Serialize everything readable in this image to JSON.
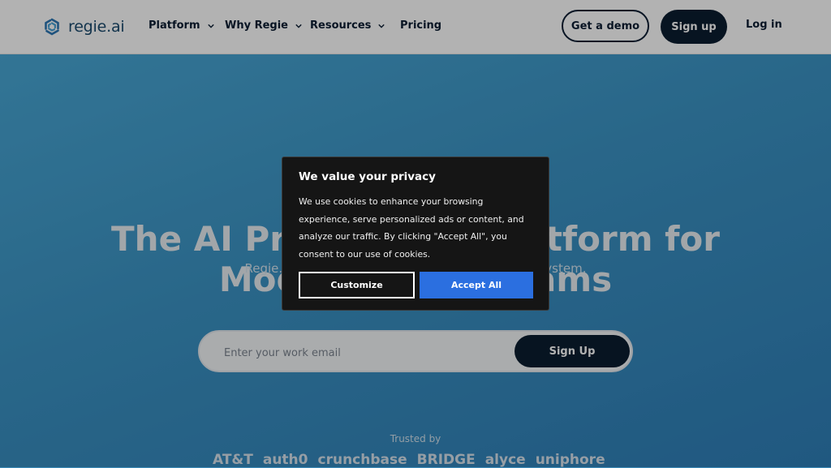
{
  "brand": {
    "name": "regie.ai",
    "color": "#1a4a6e"
  },
  "nav": {
    "items": [
      {
        "label": "Platform"
      },
      {
        "label": "Why Regie"
      },
      {
        "label": "Resources"
      },
      {
        "label": "Pricing"
      }
    ],
    "demo_label": "Get a demo",
    "signup_label": "Sign up",
    "login_label": "Log in"
  },
  "hero": {
    "title_line1": "The AI Prospecting Platform for",
    "title_line2": "Modern Sales Teams",
    "subtitle": "Regie.ai is your AI-native prospect engagement system.",
    "email_placeholder": "Enter your work email",
    "signup_label": "Sign Up",
    "trusted_label": "Trusted by",
    "logos": [
      "AT&T",
      "auth0",
      "crunchbase",
      "BRIDGE",
      "alyce",
      "uniphore"
    ]
  },
  "cookie": {
    "title": "We value your privacy",
    "body": "We use cookies to enhance your browsing experience, serve personalized ads or content, and analyze our traffic. By clicking \"Accept All\", you consent to our use of cookies.",
    "customize_label": "Customize",
    "accept_label": "Accept All"
  },
  "colors": {
    "hero_bg": "#3b93c4",
    "dark_button": "#0b1d30",
    "accept_button": "#2b6fe0",
    "modal_bg": "#151515"
  }
}
